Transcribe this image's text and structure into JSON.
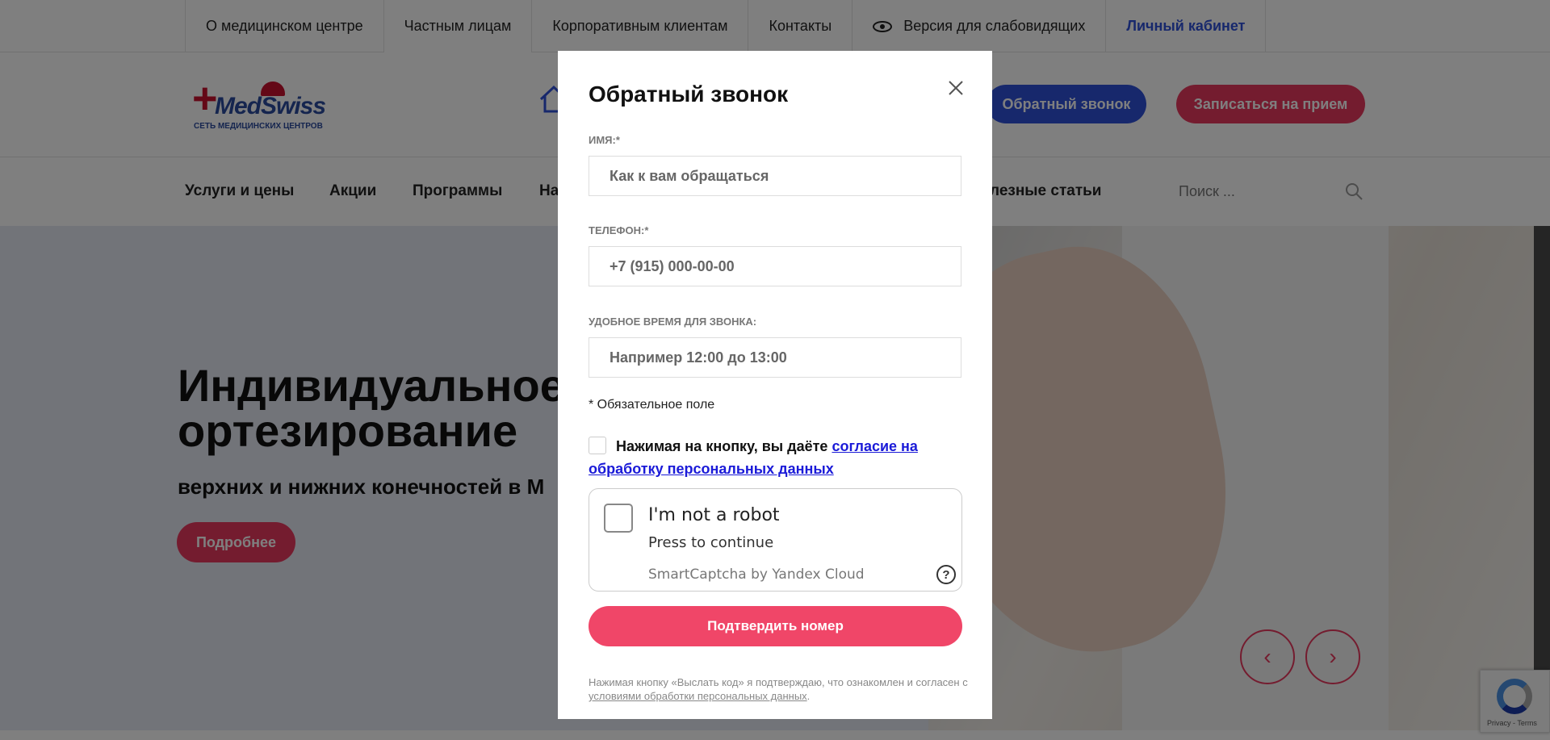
{
  "topnav": {
    "items": [
      {
        "label": "О медицинском центре"
      },
      {
        "label": "Частным лицам"
      },
      {
        "label": "Корпоративным клиентам"
      },
      {
        "label": "Контакты"
      },
      {
        "label": "Версия для слабовидящих"
      },
      {
        "label": "Личный кабинет"
      }
    ]
  },
  "header": {
    "logo_name": "MedSwiss",
    "logo_sub": "СЕТЬ МЕДИЦИНСКИХ ЦЕНТРОВ",
    "callback_label": "Обратный звонок",
    "appointment_label": "Записаться на прием"
  },
  "mainnav": {
    "items": [
      {
        "label": "Услуги и цены"
      },
      {
        "label": "Акции"
      },
      {
        "label": "Программы"
      },
      {
        "label": "На"
      },
      {
        "label": "лезные статьи"
      }
    ],
    "search_placeholder": "Поиск ..."
  },
  "hero": {
    "title": "Индивидуальное ортезирование",
    "subtitle": "верхних и нижних конечностей в М",
    "more_label": "Подробнее",
    "prev": "‹",
    "next": "›"
  },
  "modal": {
    "title": "Обратный звонок",
    "close": "×",
    "name_label": "ИМЯ:*",
    "name_placeholder": "Как к вам обращаться",
    "phone_label": "ТЕЛЕФОН:*",
    "phone_placeholder": "+7 (915) 000-00-00",
    "time_label": "УДОБНОЕ ВРЕМЯ ДЛЯ ЗВОНКА:",
    "time_placeholder": "Например 12:00 до 13:00",
    "required_note": "* Обязательное поле",
    "consent_text": "Нажимая на кнопку, вы даёте",
    "consent_link": "согласие на обработку персональных данных",
    "captcha_title": "I'm not a robot",
    "captcha_sub": "Press to continue",
    "captcha_brand": "SmartCaptcha by Yandex Cloud",
    "captcha_help": "?",
    "submit_label": "Подтвердить номер",
    "legal_text": "Нажимая кнопку «Выслать код» я подтверждаю, что ознакомлен и согласен с",
    "legal_link": "условиями обработки персональных данных",
    "legal_end": "."
  },
  "recaptcha": {
    "text": "Privacy - Terms"
  },
  "colors": {
    "accent_blue": "#2f50d8",
    "accent_pink": "#e8395e",
    "submit_pink": "#f04668"
  }
}
